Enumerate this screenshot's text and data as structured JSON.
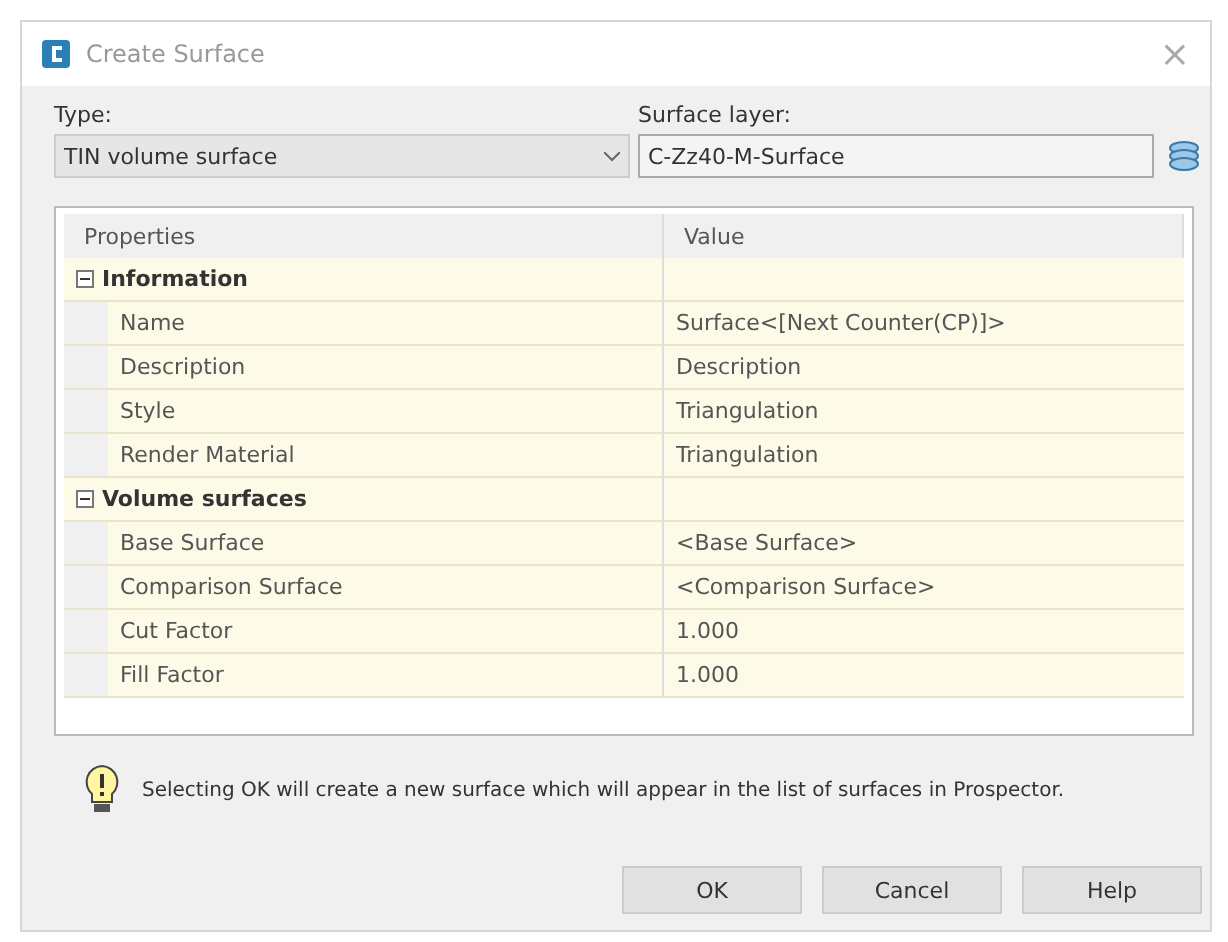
{
  "window": {
    "title": "Create Surface",
    "close": "×"
  },
  "type_field": {
    "label": "Type:",
    "value": "TIN volume surface"
  },
  "layer_field": {
    "label": "Surface layer:",
    "value": "C-Zz40-M-Surface"
  },
  "grid": {
    "columns": [
      "Properties",
      "Value"
    ],
    "categories": [
      {
        "name": "Information",
        "expanded": true,
        "rows": [
          {
            "name": "Name",
            "value": "Surface<[Next Counter(CP)]>"
          },
          {
            "name": "Description",
            "value": "Description"
          },
          {
            "name": "Style",
            "value": "Triangulation"
          },
          {
            "name": "Render Material",
            "value": "Triangulation"
          }
        ]
      },
      {
        "name": "Volume surfaces",
        "expanded": true,
        "rows": [
          {
            "name": "Base Surface",
            "value": "<Base Surface>"
          },
          {
            "name": "Comparison Surface",
            "value": "<Comparison Surface>"
          },
          {
            "name": "Cut Factor",
            "value": "1.000"
          },
          {
            "name": "Fill Factor",
            "value": "1.000"
          }
        ]
      }
    ]
  },
  "note": "Selecting OK will create a new surface which will appear in the list of surfaces in Prospector.",
  "buttons": [
    "OK",
    "Cancel",
    "Help"
  ]
}
